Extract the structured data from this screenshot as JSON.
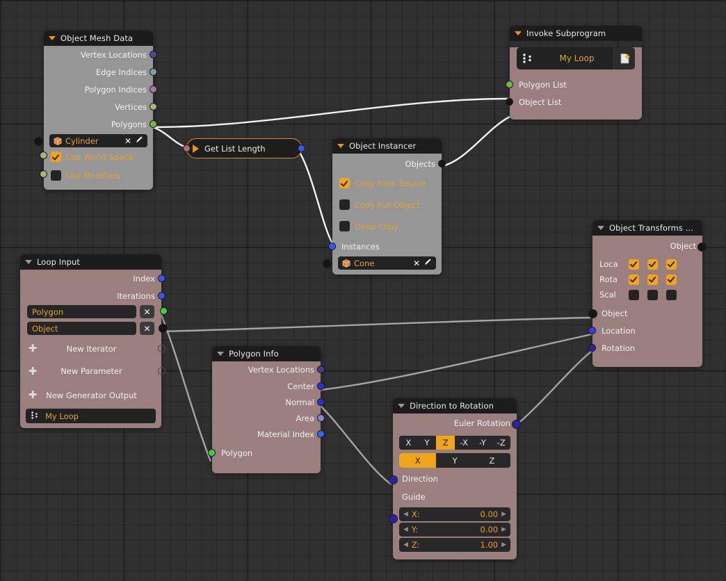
{
  "editor": {
    "name": "blender-animation-nodes-editor",
    "background": "#303030",
    "grid_color": "#262626"
  },
  "colors": {
    "accent_orange": "#e8960f",
    "selected_border": "#e08c1e",
    "node_header_bg": "#1c1c1c",
    "body_gray": "#969696",
    "body_mauve": "#9b7e7e",
    "link_white": "#f2f2f2",
    "link_gray": "#a5a5a5"
  },
  "nodes": {
    "object_mesh_data": {
      "title": "Object Mesh Data",
      "outputs": [
        "Vertex Locations",
        "Edge Indices",
        "Polygon Indices",
        "Vertices",
        "Polygons"
      ],
      "object_field": {
        "value": "Cylinder",
        "clear": "✕",
        "edit": "✎"
      },
      "checkboxes": [
        {
          "label": "Use World Space",
          "checked": true
        },
        {
          "label": "Use Modifiers",
          "checked": false
        }
      ]
    },
    "get_list_length": {
      "title": "Get List Length"
    },
    "invoke_subprogram": {
      "title": "Invoke Subprogram",
      "subprogram_button": "My Loop",
      "inputs": [
        "Polygon List",
        "Object List"
      ]
    },
    "object_instancer": {
      "title": "Object Instancer",
      "outputs": [
        "Objects"
      ],
      "checkboxes": [
        {
          "label": "Copy from Source",
          "checked": true
        },
        {
          "label": "Copy Full Object",
          "checked": false
        },
        {
          "label": "Deep Copy",
          "checked": false
        }
      ],
      "inputs": [
        "Instances"
      ],
      "object_field": {
        "value": "Cone",
        "clear": "✕",
        "edit": "✎"
      }
    },
    "object_transforms": {
      "title": "Object Transforms ...",
      "outputs": [
        "Object"
      ],
      "matrix_rows": [
        {
          "label": "Loca",
          "values": [
            true,
            true,
            true
          ]
        },
        {
          "label": "Rota",
          "values": [
            true,
            true,
            true
          ]
        },
        {
          "label": "Scal",
          "values": [
            false,
            false,
            false
          ]
        }
      ],
      "inputs": [
        "Object",
        "Location",
        "Rotation"
      ]
    },
    "loop_input": {
      "title": "Loop Input",
      "outputs": [
        "Index",
        "Iterations"
      ],
      "iterators": [
        {
          "name": "Polygon",
          "remove": "✕"
        },
        {
          "name": "Object",
          "remove": "✕"
        }
      ],
      "actions": [
        "New Iterator",
        "New Parameter",
        "New Generator Output"
      ],
      "subprogram_button": "My Loop"
    },
    "polygon_info": {
      "title": "Polygon Info",
      "outputs": [
        "Vertex Locations",
        "Center",
        "Normal",
        "Area",
        "Material Index"
      ],
      "inputs": [
        "Polygon"
      ]
    },
    "direction_to_rotation": {
      "title": "Direction to Rotation",
      "outputs": [
        "Euler Rotation"
      ],
      "axis_enum": {
        "options": [
          "X",
          "Y",
          "Z",
          "-X",
          "-Y",
          "-Z"
        ],
        "selected": "Z"
      },
      "guide_enum": {
        "options": [
          "X",
          "Y",
          "Z"
        ],
        "selected": "X"
      },
      "inputs": [
        "Direction",
        "Guide"
      ],
      "guide_vector": [
        {
          "label": "X:",
          "value": "0.00"
        },
        {
          "label": "Y:",
          "value": "0.00"
        },
        {
          "label": "Z:",
          "value": "1.00"
        }
      ]
    }
  }
}
